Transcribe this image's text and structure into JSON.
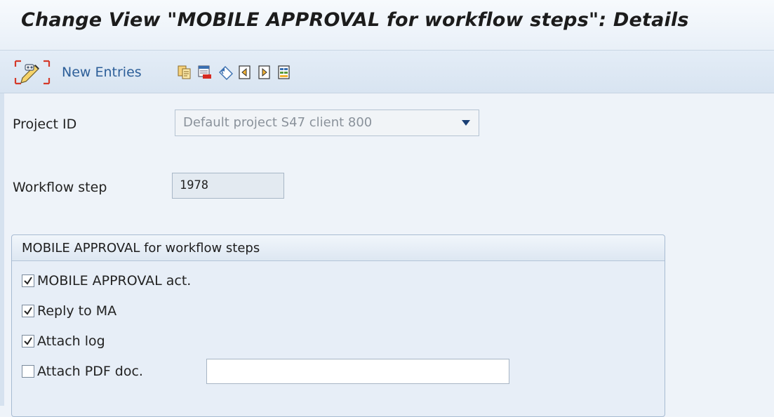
{
  "window": {
    "title": "Change View \"MOBILE APPROVAL for workflow steps\": Details"
  },
  "toolbar": {
    "toggle_icon": "display-change-toggle-icon",
    "new_entries_label": "New Entries",
    "icons": [
      "copy-icon",
      "delete-icon",
      "undo-change-icon",
      "previous-entry-icon",
      "next-entry-icon",
      "select-block-icon"
    ]
  },
  "form": {
    "project_id": {
      "label": "Project ID",
      "value": "Default project S47 client 800"
    },
    "workflow_step": {
      "label": "Workflow step",
      "value": "1978"
    }
  },
  "group": {
    "title": "MOBILE APPROVAL for workflow steps",
    "checkboxes": [
      {
        "label": "MOBILE APPROVAL act.",
        "checked": true
      },
      {
        "label": "Reply to MA",
        "checked": true
      },
      {
        "label": "Attach log",
        "checked": true
      },
      {
        "label": "Attach PDF doc.",
        "checked": false
      }
    ],
    "pdf_doc_value": ""
  },
  "colors": {
    "link_blue": "#2d5f99",
    "background": "#eef3f9",
    "toolbar": "#dce7f3"
  }
}
